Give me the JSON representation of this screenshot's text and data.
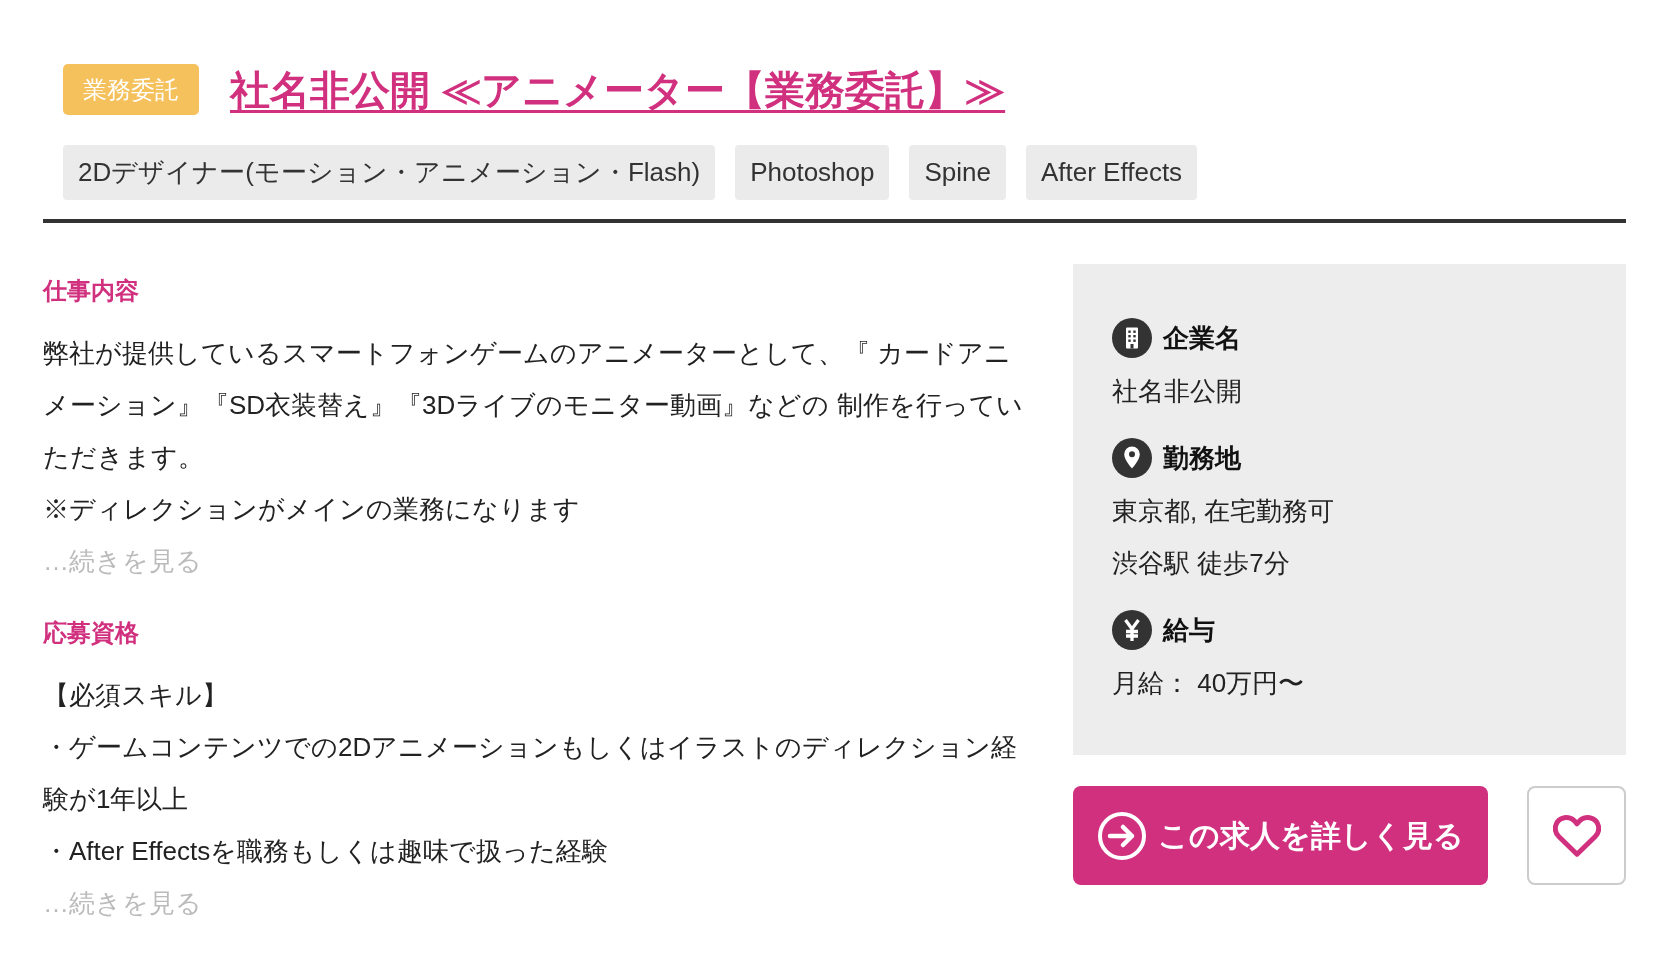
{
  "header": {
    "badge": "業務委託",
    "title": "社名非公開 ≪アニメーター【業務委託】≫",
    "tags": [
      "2Dデザイナー(モーション・アニメーション・Flash)",
      "Photoshop",
      "Spine",
      "After Effects"
    ]
  },
  "sections": [
    {
      "heading": "仕事内容",
      "paragraphs": [
        "弊社が提供しているスマートフォンゲームのアニメーターとして、『 カードアニメーション』『SD衣装替え』『3Dライブのモニター動画』などの 制作を行っていただきます。",
        "※ディレクションがメインの業務になります"
      ],
      "more_link": "…続きを見る"
    },
    {
      "heading": "応募資格",
      "paragraphs": [
        "【必須スキル】",
        "・ゲームコンテンツでの2Dアニメーションもしくはイラストのディレクション経験が1年以上",
        "・After Effectsを職務もしくは趣味で扱った経験"
      ],
      "more_link": "…続きを見る"
    }
  ],
  "info_panel": {
    "items": [
      {
        "kind": "company",
        "label": "企業名",
        "values": [
          "社名非公開"
        ]
      },
      {
        "kind": "location",
        "label": "勤務地",
        "values": [
          "東京都, 在宅勤務可",
          "渋谷駅 徒歩7分"
        ]
      },
      {
        "kind": "salary",
        "label": "給与",
        "values": [
          "月給： 40万円〜"
        ]
      }
    ]
  },
  "actions": {
    "detail_button": "この求人を詳しく見る"
  }
}
